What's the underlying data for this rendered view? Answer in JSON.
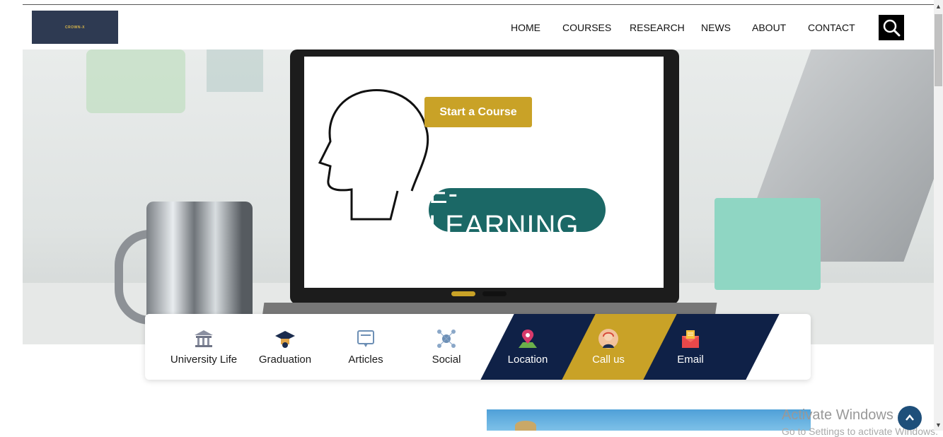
{
  "brand": {
    "logo_text": "CROWN-X"
  },
  "nav": {
    "items": [
      {
        "label": "HOME"
      },
      {
        "label": "COURSES"
      },
      {
        "label": "RESEARCH"
      },
      {
        "label": "NEWS"
      },
      {
        "label": "ABOUT"
      },
      {
        "label": "CONTACT"
      }
    ],
    "search_icon": "search-icon"
  },
  "hero": {
    "cta_label": "Start a Course",
    "screen_text": "E-LEARNING",
    "slider": {
      "slides": 2,
      "active_index": 0,
      "active_color": "#c9a227",
      "inactive_color": "#111111"
    }
  },
  "features": [
    {
      "label": "University Life",
      "icon": "university-icon"
    },
    {
      "label": "Graduation",
      "icon": "graduation-cap-icon"
    },
    {
      "label": "Articles",
      "icon": "articles-icon"
    },
    {
      "label": "Social",
      "icon": "social-network-icon"
    },
    {
      "label": "Location",
      "icon": "location-pin-icon"
    },
    {
      "label": "Call us",
      "icon": "support-agent-icon"
    },
    {
      "label": "Email",
      "icon": "email-icon"
    }
  ],
  "colors": {
    "gold": "#c9a227",
    "navy": "#0f2147",
    "dark_button": "#1e4f7a"
  },
  "watermark": {
    "title": "Activate Windows",
    "subtitle": "Go to Settings to activate Windows."
  }
}
